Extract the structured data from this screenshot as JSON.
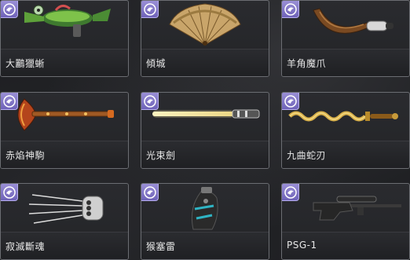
{
  "badge_icon": "grade-medal-icon",
  "badge_color": "#7f73c8",
  "items": [
    {
      "name": "大鸝獵蜥"
    },
    {
      "name": "傾城"
    },
    {
      "name": "羊角魔爪"
    },
    {
      "name": "赤焰神駒"
    },
    {
      "name": "光束劍"
    },
    {
      "name": "九曲蛇刃"
    },
    {
      "name": "寂滅斷魂"
    },
    {
      "name": "猴塞雷"
    },
    {
      "name": "PSG-1"
    }
  ]
}
